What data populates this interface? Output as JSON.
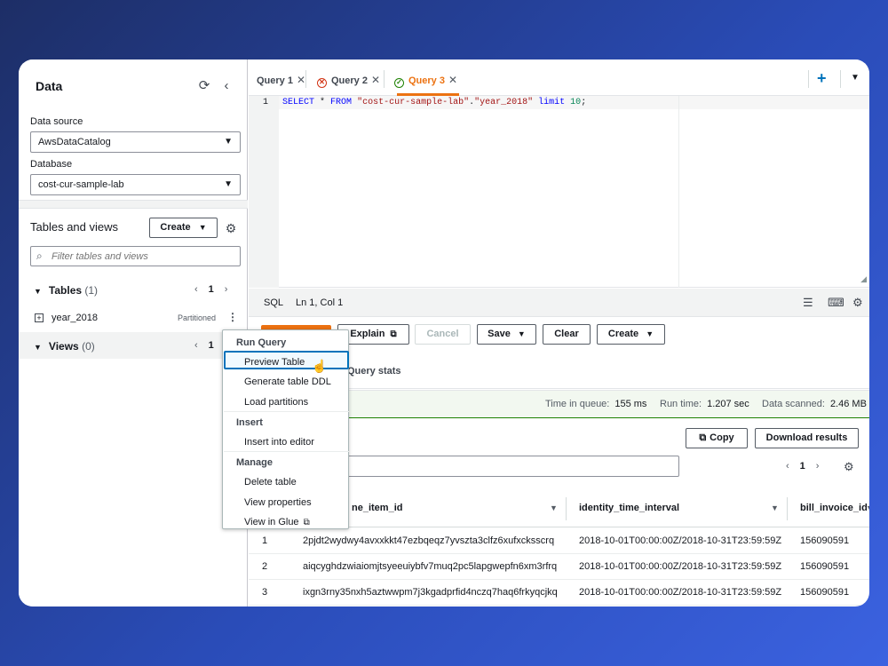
{
  "left": {
    "title": "Data",
    "data_source_label": "Data source",
    "data_source_value": "AwsDataCatalog",
    "database_label": "Database",
    "database_value": "cost-cur-sample-lab",
    "tables_views_title": "Tables and views",
    "create_label": "Create",
    "filter_placeholder": "Filter tables and views",
    "tables_label": "Tables",
    "tables_count": "(1)",
    "tables_page": "1",
    "table_name": "year_2018",
    "table_badge": "Partitioned",
    "views_label": "Views",
    "views_count": "(0)",
    "views_page": "1"
  },
  "tabs": [
    {
      "label": "Query 1",
      "status": "none"
    },
    {
      "label": "Query 2",
      "status": "error"
    },
    {
      "label": "Query 3",
      "status": "success",
      "active": true
    }
  ],
  "editor": {
    "line_number": "1",
    "code": {
      "kw1": "SELECT",
      "mid1": " * ",
      "kw2": "FROM",
      "sp": " ",
      "str1": "\"cost-cur-sample-lab\"",
      "dot": ".",
      "str2": "\"year_2018\"",
      "sp2": " ",
      "kw3": "limit",
      "sp3": " ",
      "num": "10",
      "end": ";"
    }
  },
  "statusbar": {
    "lang": "SQL",
    "position": "Ln 1, Col 1"
  },
  "actions": {
    "explain": "Explain",
    "cancel": "Cancel",
    "save": "Save",
    "clear": "Clear",
    "create": "Create"
  },
  "results_tab": "Query stats",
  "stats": {
    "queue_label": "Time in queue:",
    "queue_value": "155 ms",
    "run_label": "Run time:",
    "run_value": "1.207 sec",
    "scan_label": "Data scanned:",
    "scan_value": "2.46 MB"
  },
  "results": {
    "copy": "Copy",
    "download": "Download results",
    "page": "1",
    "columns": [
      "ne_item_id",
      "identity_time_interval",
      "bill_invoice_id"
    ],
    "rows": [
      [
        "1",
        "2pjdt2wydwy4avxxkkt47ezbqeqz7yvszta3clfz6xufxcksscrq",
        "2018-10-01T00:00:00Z/2018-10-31T23:59:59Z",
        "156090591"
      ],
      [
        "2",
        "aiqcyghdzwiaiomjtsyeeuiybfv7muq2pc5lapgwepfn6xm3rfrq",
        "2018-10-01T00:00:00Z/2018-10-31T23:59:59Z",
        "156090591"
      ],
      [
        "3",
        "ixgn3rny35nxh5aztwwpm7j3kgadprfid4nczq7haq6frkyqcjkq",
        "2018-10-01T00:00:00Z/2018-10-31T23:59:59Z",
        "156090591"
      ]
    ]
  },
  "menu": {
    "group_run": "Run Query",
    "preview": "Preview Table",
    "ddl": "Generate table DDL",
    "load": "Load partitions",
    "group_insert": "Insert",
    "insert_editor": "Insert into editor",
    "group_manage": "Manage",
    "delete": "Delete table",
    "properties": "View properties",
    "glue": "View in Glue"
  },
  "colors": {
    "accent": "#ec7211",
    "link": "#0073bb",
    "success": "#1d8102",
    "error": "#d13212"
  }
}
